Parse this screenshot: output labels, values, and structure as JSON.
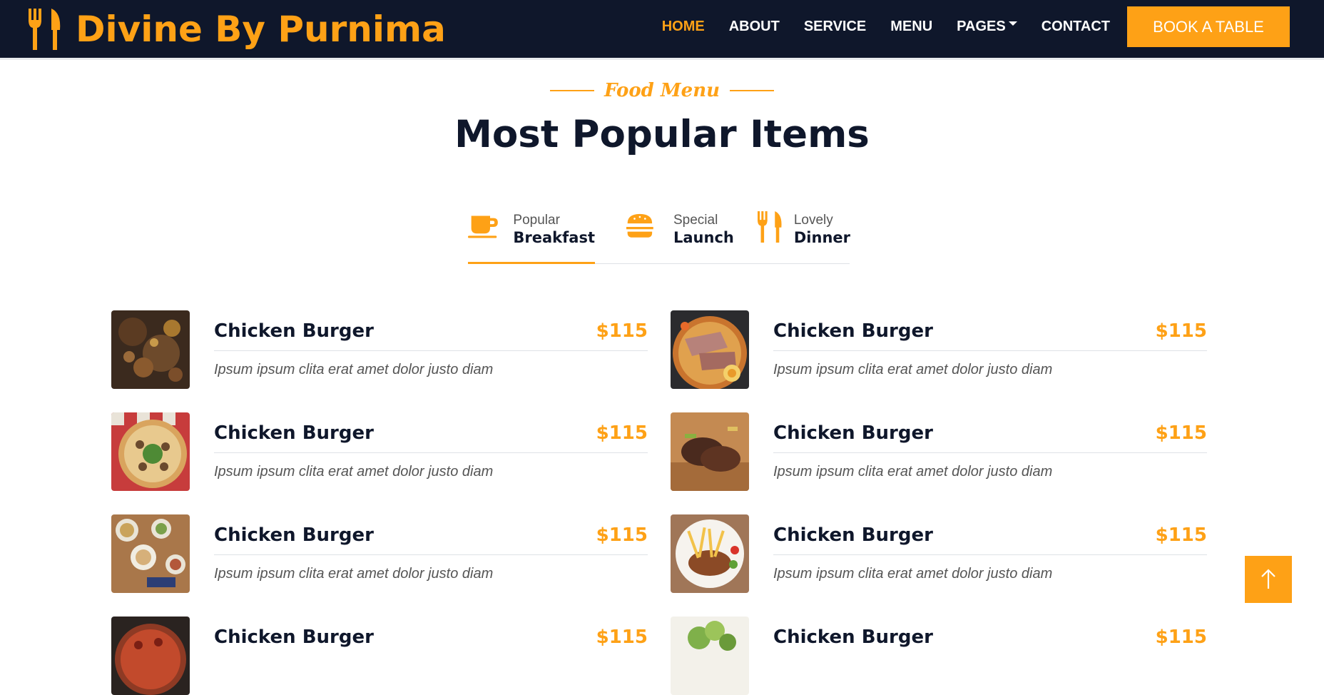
{
  "brand": {
    "name": "Divine By Purnima",
    "icon": "utensils-icon"
  },
  "nav": {
    "items": [
      {
        "label": "HOME",
        "active": true
      },
      {
        "label": "ABOUT",
        "active": false
      },
      {
        "label": "SERVICE",
        "active": false
      },
      {
        "label": "MENU",
        "active": false
      },
      {
        "label": "PAGES",
        "active": false,
        "dropdown": true
      },
      {
        "label": "CONTACT",
        "active": false
      }
    ],
    "cta": "BOOK A TABLE"
  },
  "section": {
    "subtitle": "Food Menu",
    "title": "Most Popular Items"
  },
  "tabs": [
    {
      "small": "Popular",
      "big": "Breakfast",
      "icon": "coffee-cup-icon",
      "active": true
    },
    {
      "small": "Special",
      "big": "Launch",
      "icon": "hamburger-icon",
      "active": false
    },
    {
      "small": "Lovely",
      "big": "Dinner",
      "icon": "utensils-icon",
      "active": false
    }
  ],
  "menu_items": [
    {
      "name": "Chicken Burger",
      "price": "$115",
      "desc": "Ipsum ipsum clita erat amet dolor justo diam"
    },
    {
      "name": "Chicken Burger",
      "price": "$115",
      "desc": "Ipsum ipsum clita erat amet dolor justo diam"
    },
    {
      "name": "Chicken Burger",
      "price": "$115",
      "desc": "Ipsum ipsum clita erat amet dolor justo diam"
    },
    {
      "name": "Chicken Burger",
      "price": "$115",
      "desc": "Ipsum ipsum clita erat amet dolor justo diam"
    },
    {
      "name": "Chicken Burger",
      "price": "$115",
      "desc": "Ipsum ipsum clita erat amet dolor justo diam"
    },
    {
      "name": "Chicken Burger",
      "price": "$115",
      "desc": "Ipsum ipsum clita erat amet dolor justo diam"
    },
    {
      "name": "Chicken Burger",
      "price": "$115",
      "desc": ""
    },
    {
      "name": "Chicken Burger",
      "price": "$115",
      "desc": ""
    }
  ],
  "colors": {
    "primary": "#fea116",
    "dark": "#0f172b",
    "text_muted": "#555555"
  },
  "back_to_top": {
    "icon": "arrow-up-icon"
  }
}
